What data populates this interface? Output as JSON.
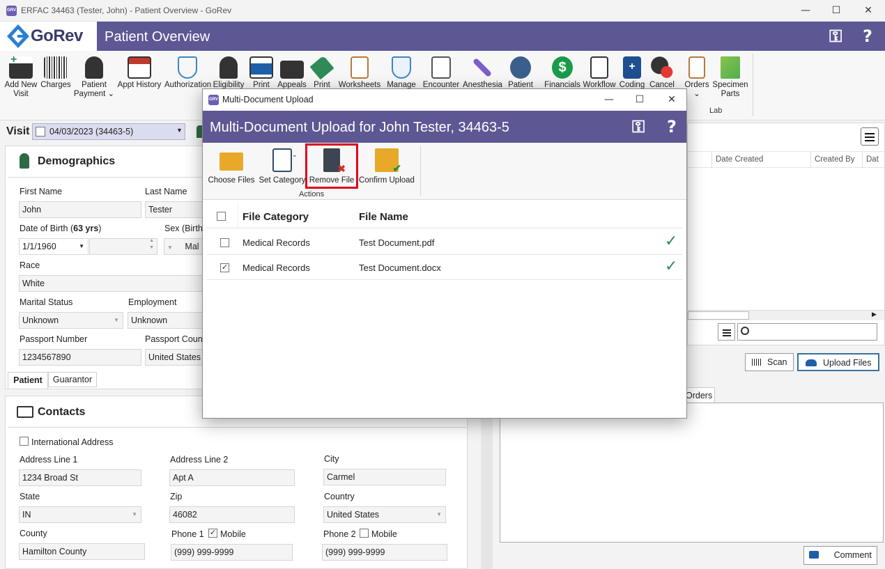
{
  "window": {
    "title": "ERFAC 34463 (Tester, John) - Patient Overview - GoRev",
    "controls": [
      "—",
      "☐",
      "✕"
    ]
  },
  "header": {
    "logo": "GoRev",
    "title": "Patient Overview"
  },
  "ribbon": {
    "items": [
      {
        "label_l1": "Add New",
        "label_l2": "Visit",
        "icon": "add-visit-icon"
      },
      {
        "label_l1": "Charges",
        "label_l2": "",
        "icon": "barcode-icon"
      },
      {
        "label_l1": "Patient",
        "label_l2": "Payment ⌄",
        "icon": "payment-icon"
      },
      {
        "label_l1": "Appt History",
        "label_l2": "",
        "icon": "calendar-icon"
      },
      {
        "label_l1": "Authorization",
        "label_l2": "",
        "icon": "shield-icon"
      },
      {
        "label_l1": "Eligibility",
        "label_l2": "",
        "icon": "person-check-icon"
      },
      {
        "label_l1": "Print",
        "label_l2": "",
        "icon": "printer-icon"
      },
      {
        "label_l1": "Appeals",
        "label_l2": "",
        "icon": "briefcase-icon"
      },
      {
        "label_l1": "Print",
        "label_l2": "",
        "icon": "tag-icon"
      },
      {
        "label_l1": "Worksheets",
        "label_l2": "",
        "icon": "worksheet-icon"
      },
      {
        "label_l1": "Manage",
        "label_l2": "",
        "icon": "manage-shield-icon"
      },
      {
        "label_l1": "Encounter",
        "label_l2": "",
        "icon": "encounter-icon"
      },
      {
        "label_l1": "Anesthesia",
        "label_l2": "",
        "icon": "syringe-icon"
      },
      {
        "label_l1": "Patient",
        "label_l2": "",
        "icon": "globe-gear-icon"
      },
      {
        "label_l1": "Financials",
        "label_l2": "",
        "icon": "dollar-icon"
      },
      {
        "label_l1": "Workflow",
        "label_l2": "",
        "icon": "workflow-icon"
      },
      {
        "label_l1": "Coding",
        "label_l2": "",
        "icon": "book-icon"
      },
      {
        "label_l1": "Cancel",
        "label_l2": "",
        "icon": "cancel-clock-icon"
      },
      {
        "label_l1": "Orders",
        "label_l2": "⌄",
        "icon": "orders-icon"
      },
      {
        "label_l1": "Specimen",
        "label_l2": "Parts",
        "icon": "specimen-icon"
      }
    ],
    "lab_group": "Lab"
  },
  "visit": {
    "label": "Visit",
    "value": "04/03/2023 (34463-5)"
  },
  "demographics": {
    "title": "Demographics",
    "first_name_label": "First Name",
    "first_name": "John",
    "last_name_label": "Last Name",
    "last_name": "Tester",
    "dob_label": "Date of Birth (",
    "dob_age": "63 yrs",
    "dob_close": ")",
    "dob": "1/1/1960",
    "sex_label": "Sex (Birth",
    "sex_value": "Mal",
    "race_label": "Race",
    "race": "White",
    "marital_label": "Marital Status",
    "marital": "Unknown",
    "employment_label": "Employment",
    "employment": "Unknown",
    "passport_label": "Passport Number",
    "passport": "1234567890",
    "passport_country_label": "Passport Coun",
    "passport_country": "United States",
    "tabs": [
      "Patient",
      "Guarantor"
    ]
  },
  "contacts": {
    "title": "Contacts",
    "international": "International Address",
    "addr1_label": "Address Line 1",
    "addr1": "1234 Broad St",
    "addr2_label": "Address Line 2",
    "addr2": "Apt A",
    "city_label": "City",
    "city": "Carmel",
    "state_label": "State",
    "state": "IN",
    "zip_label": "Zip",
    "zip": "46082",
    "country_label": "Country",
    "country": "United States",
    "county_label": "County",
    "county": "Hamilton County",
    "phone1_label": "Phone 1",
    "phone1_mobile": "Mobile",
    "phone1": "(999) 999-9999",
    "phone2_label": "Phone 2",
    "phone2_mobile": "Mobile",
    "phone2": "(999) 999-9999"
  },
  "right_panel": {
    "columns": [
      "Date Created",
      "Created By",
      "Dat"
    ],
    "scan_label": "Scan",
    "upload_label": "Upload Files",
    "orders_tab": "Orders",
    "comment_label": "Comment"
  },
  "dialog": {
    "window_title": "Multi-Document Upload",
    "header_title": "Multi-Document Upload for John Tester, 34463-5",
    "toolbar": {
      "choose_files": "Choose Files",
      "set_category": "Set Category",
      "remove_file": "Remove File",
      "confirm_upload": "Confirm Upload",
      "group_label": "Actions"
    },
    "grid": {
      "col_category": "File Category",
      "col_name": "File Name",
      "rows": [
        {
          "category": "Medical Records",
          "name": "Test Document.pdf",
          "checked": false
        },
        {
          "category": "Medical Records",
          "name": "Test Document.docx",
          "checked": true
        }
      ]
    },
    "highlight_color": "#e0001b"
  }
}
